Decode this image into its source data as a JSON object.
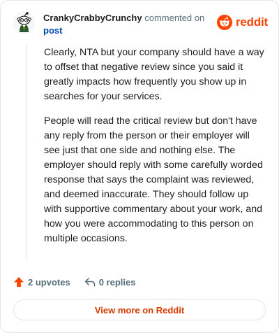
{
  "header": {
    "author": "CrankyCrabbyCrunchy",
    "action": "commented on",
    "post_link": "post",
    "avatar_icon": "snoo-avatar-icon"
  },
  "brand": {
    "icon": "reddit-snoo-icon",
    "wordmark": "reddit",
    "color": "#ff4500"
  },
  "comment": {
    "paragraphs": [
      "Clearly, NTA but your company should have a way to offset that negative review since you said it greatly impacts how frequently you show up in searches for your services.",
      "People will read the critical review but don't have any reply from the person or their employer will see just that one side and nothing else. The employer should reply with some carefully worded response that says the complaint was reviewed, and deemed inaccurate. They should follow up with supportive commentary about your work, and how you were accommodating to this person on multiple occasions."
    ]
  },
  "footer": {
    "upvotes_label": "2 upvotes",
    "upvote_icon": "upvote-arrow-icon",
    "upvote_color": "#ff4500",
    "replies_label": "0 replies",
    "reply_icon": "reply-arrow-icon"
  },
  "cta": {
    "label": "View more on Reddit",
    "color": "#d93a00"
  }
}
